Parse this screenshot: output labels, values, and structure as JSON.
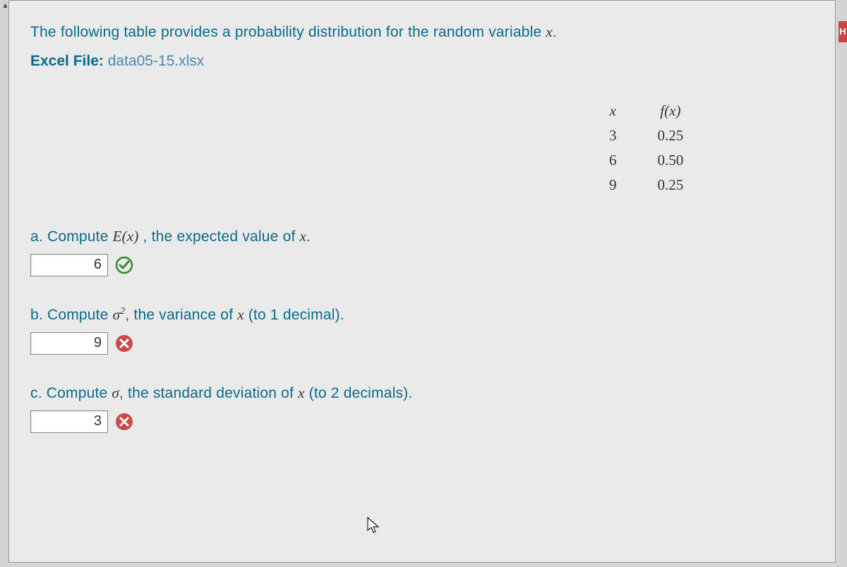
{
  "intro_text": "The following table provides a probability distribution for the random variable ",
  "intro_var": "x",
  "intro_period": ".",
  "file_label": "Excel File: ",
  "file_name": "data05-15.xlsx",
  "table": {
    "headers": {
      "x": "x",
      "fx": "f(x)"
    },
    "rows": [
      {
        "x": "3",
        "fx": "0.25"
      },
      {
        "x": "6",
        "fx": "0.50"
      },
      {
        "x": "9",
        "fx": "0.25"
      }
    ]
  },
  "questions": {
    "a": {
      "prefix": "a. Compute ",
      "expr": "E(x)",
      "suffix": " , the expected value of ",
      "var": "x",
      "period": ".",
      "value": "6",
      "status": "correct"
    },
    "b": {
      "prefix": "b. Compute ",
      "sigma": "σ",
      "sup": "2",
      "suffix": ", the variance of ",
      "var": "x",
      "paren": " (to 1 decimal).",
      "value": "9",
      "status": "incorrect"
    },
    "c": {
      "prefix": "c. Compute ",
      "sigma": "σ",
      "suffix": ", the standard deviation of ",
      "var": "x",
      "paren": " (to 2 decimals).",
      "value": "3",
      "status": "incorrect"
    }
  },
  "right_tab": "H"
}
